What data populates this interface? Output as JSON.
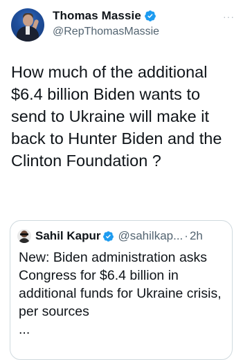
{
  "tweet": {
    "author": {
      "display_name": "Thomas Massie",
      "handle": "@RepThomasMassie",
      "verified": true
    },
    "more_label": "···",
    "text": "How much of the additional $6.4 billion Biden wants to send to Ukraine will make it back to Hunter Biden and the Clinton Foundation ?"
  },
  "quoted_tweet": {
    "author": {
      "display_name": "Sahil Kapur",
      "handle": "@sahilkap...",
      "verified": true
    },
    "separator": "·",
    "time": "2h",
    "text": "New: Biden administration asks Congress for $6.4 billion in additional funds for Ukraine crisis, per sources",
    "ellipsis": "..."
  },
  "colors": {
    "verified_badge": "#1d9bf0",
    "text_primary": "#0f1419",
    "text_secondary": "#536471",
    "border": "#cfd9de"
  },
  "icons": {
    "verified": "verified-badge-icon",
    "more": "more-options-icon"
  }
}
